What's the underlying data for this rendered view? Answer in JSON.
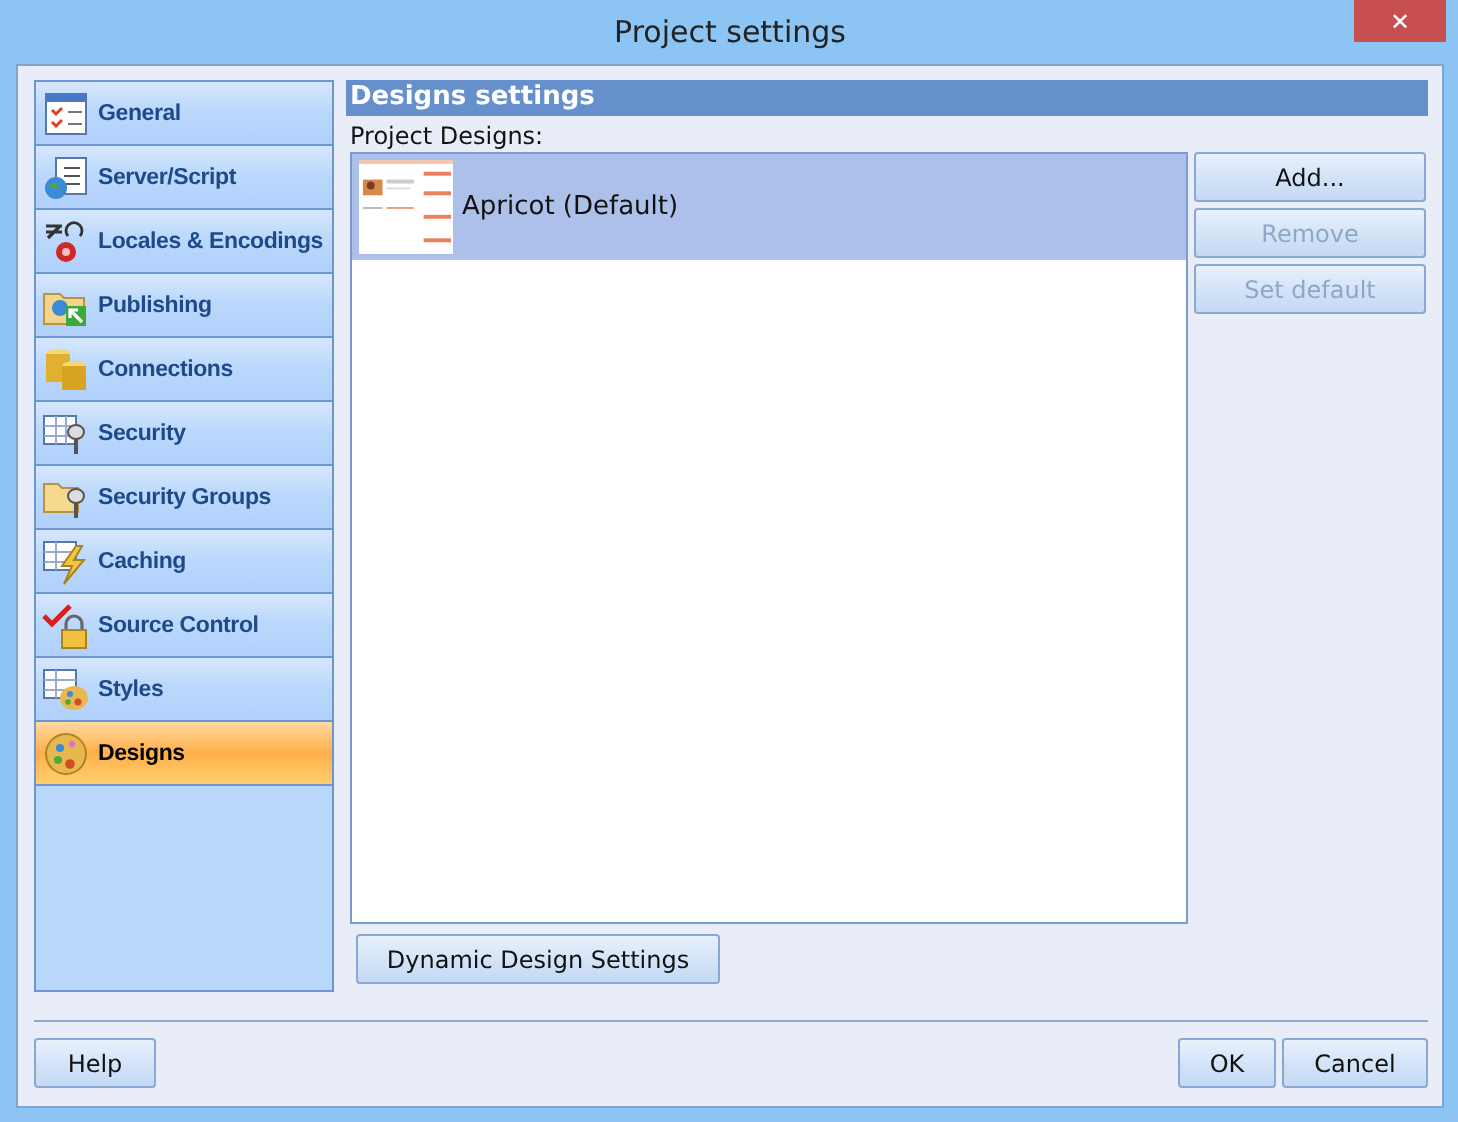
{
  "window": {
    "title": "Project settings",
    "close": "✕"
  },
  "sidebar": {
    "items": [
      {
        "label": "General",
        "selected": false
      },
      {
        "label": "Server/Script",
        "selected": false
      },
      {
        "label": "Locales & Encodings",
        "selected": false
      },
      {
        "label": "Publishing",
        "selected": false
      },
      {
        "label": "Connections",
        "selected": false
      },
      {
        "label": "Security",
        "selected": false
      },
      {
        "label": "Security Groups",
        "selected": false
      },
      {
        "label": "Caching",
        "selected": false
      },
      {
        "label": "Source Control",
        "selected": false
      },
      {
        "label": "Styles",
        "selected": false
      },
      {
        "label": "Designs",
        "selected": true
      }
    ]
  },
  "panel": {
    "header": "Designs settings",
    "list_label": "Project Designs:",
    "designs": [
      {
        "name": "Apricot (Default)",
        "selected": true
      }
    ],
    "side_buttons": [
      {
        "label": "Add...",
        "disabled": false
      },
      {
        "label": "Remove",
        "disabled": true
      },
      {
        "label": "Set default",
        "disabled": true
      }
    ],
    "dynamic_button": "Dynamic Design Settings"
  },
  "footer": {
    "help": "Help",
    "ok": "OK",
    "cancel": "Cancel"
  }
}
